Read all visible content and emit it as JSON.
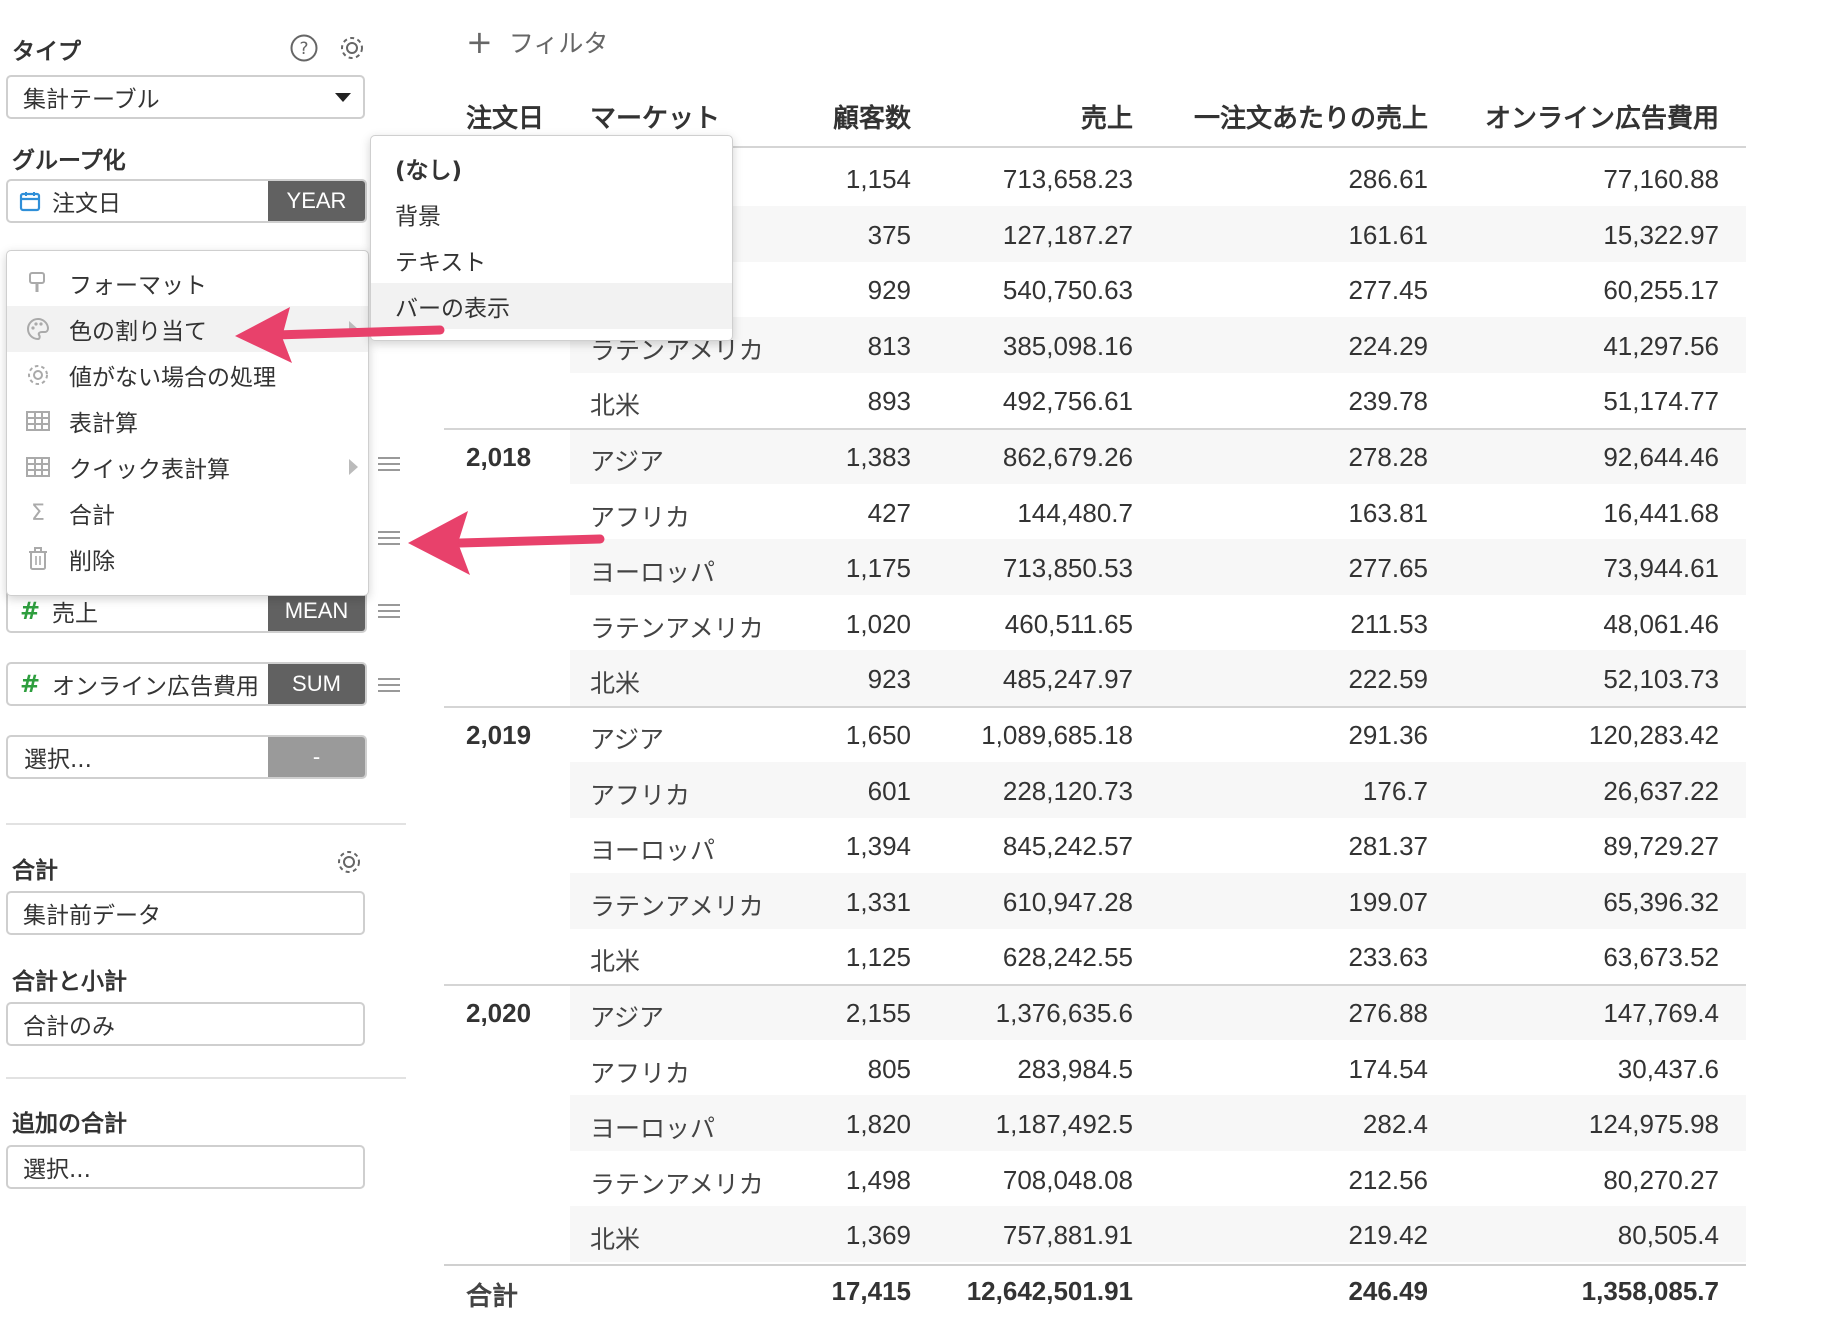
{
  "sidebar": {
    "type_label": "タイプ",
    "type_value": "集計テーブル",
    "group_label": "グループ化",
    "group_field": {
      "name": "注文日",
      "agg": "YEAR"
    },
    "values_fields": [
      {
        "name": "売上",
        "agg": "MEAN"
      },
      {
        "name": "オンライン広告費用",
        "agg": "SUM"
      }
    ],
    "select_placeholder": "選択...",
    "select_agg": "-",
    "total_label": "合計",
    "total_value": "集計前データ",
    "subtotal_label": "合計と小計",
    "subtotal_value": "合計のみ",
    "extra_total_label": "追加の合計",
    "extra_total_value": "選択..."
  },
  "context_menu": {
    "items": [
      {
        "label": "フォーマット",
        "icon": "paint-brush-icon"
      },
      {
        "label": "色の割り当て",
        "icon": "palette-icon"
      },
      {
        "label": "値がない場合の処理",
        "icon": "gear-icon"
      },
      {
        "label": "表計算",
        "icon": "table-icon"
      },
      {
        "label": "クイック表計算",
        "icon": "table-icon"
      },
      {
        "label": "合計",
        "icon": "sigma-icon"
      },
      {
        "label": "削除",
        "icon": "trash-icon"
      }
    ]
  },
  "submenu": {
    "items": [
      {
        "label": "(なし)"
      },
      {
        "label": "背景"
      },
      {
        "label": "テキスト"
      },
      {
        "label": "バーの表示"
      }
    ]
  },
  "filter_label": "フィルタ",
  "table": {
    "headers": [
      "注文日",
      "マーケット",
      "顧客数",
      "売上",
      "一注文あたりの売上",
      "オンライン広告費用"
    ],
    "rows": [
      {
        "year": "",
        "market": "",
        "customers": "1,154",
        "sales": "713,658.23",
        "per_order": "286.61",
        "ad": "77,160.88"
      },
      {
        "year": "",
        "market": "",
        "customers": "375",
        "sales": "127,187.27",
        "per_order": "161.61",
        "ad": "15,322.97"
      },
      {
        "year": "",
        "market": "",
        "customers": "929",
        "sales": "540,750.63",
        "per_order": "277.45",
        "ad": "60,255.17"
      },
      {
        "year": "",
        "market": "ラテンアメリカ",
        "customers": "813",
        "sales": "385,098.16",
        "per_order": "224.29",
        "ad": "41,297.56"
      },
      {
        "year": "",
        "market": "北米",
        "customers": "893",
        "sales": "492,756.61",
        "per_order": "239.78",
        "ad": "51,174.77"
      },
      {
        "year": "2,018",
        "market": "アジア",
        "customers": "1,383",
        "sales": "862,679.26",
        "per_order": "278.28",
        "ad": "92,644.46"
      },
      {
        "year": "",
        "market": "アフリカ",
        "customers": "427",
        "sales": "144,480.7",
        "per_order": "163.81",
        "ad": "16,441.68"
      },
      {
        "year": "",
        "market": "ヨーロッパ",
        "customers": "1,175",
        "sales": "713,850.53",
        "per_order": "277.65",
        "ad": "73,944.61"
      },
      {
        "year": "",
        "market": "ラテンアメリカ",
        "customers": "1,020",
        "sales": "460,511.65",
        "per_order": "211.53",
        "ad": "48,061.46"
      },
      {
        "year": "",
        "market": "北米",
        "customers": "923",
        "sales": "485,247.97",
        "per_order": "222.59",
        "ad": "52,103.73"
      },
      {
        "year": "2,019",
        "market": "アジア",
        "customers": "1,650",
        "sales": "1,089,685.18",
        "per_order": "291.36",
        "ad": "120,283.42"
      },
      {
        "year": "",
        "market": "アフリカ",
        "customers": "601",
        "sales": "228,120.73",
        "per_order": "176.7",
        "ad": "26,637.22"
      },
      {
        "year": "",
        "market": "ヨーロッパ",
        "customers": "1,394",
        "sales": "845,242.57",
        "per_order": "281.37",
        "ad": "89,729.27"
      },
      {
        "year": "",
        "market": "ラテンアメリカ",
        "customers": "1,331",
        "sales": "610,947.28",
        "per_order": "199.07",
        "ad": "65,396.32"
      },
      {
        "year": "",
        "market": "北米",
        "customers": "1,125",
        "sales": "628,242.55",
        "per_order": "233.63",
        "ad": "63,673.52"
      },
      {
        "year": "2,020",
        "market": "アジア",
        "customers": "2,155",
        "sales": "1,376,635.6",
        "per_order": "276.88",
        "ad": "147,769.4"
      },
      {
        "year": "",
        "market": "アフリカ",
        "customers": "805",
        "sales": "283,984.5",
        "per_order": "174.54",
        "ad": "30,437.6"
      },
      {
        "year": "",
        "market": "ヨーロッパ",
        "customers": "1,820",
        "sales": "1,187,492.5",
        "per_order": "282.4",
        "ad": "124,975.98"
      },
      {
        "year": "",
        "market": "ラテンアメリカ",
        "customers": "1,498",
        "sales": "708,048.08",
        "per_order": "212.56",
        "ad": "80,270.27"
      },
      {
        "year": "",
        "market": "北米",
        "customers": "1,369",
        "sales": "757,881.91",
        "per_order": "219.42",
        "ad": "80,505.4"
      }
    ],
    "total": {
      "label": "合計",
      "customers": "17,415",
      "sales": "12,642,501.91",
      "per_order": "246.49",
      "ad": "1,358,085.7"
    }
  },
  "colors": {
    "accent_arrow": "#e8416b",
    "agg_badge": "#616161",
    "hash_green": "#2e9e3e",
    "calendar_blue": "#2f8fd8"
  }
}
